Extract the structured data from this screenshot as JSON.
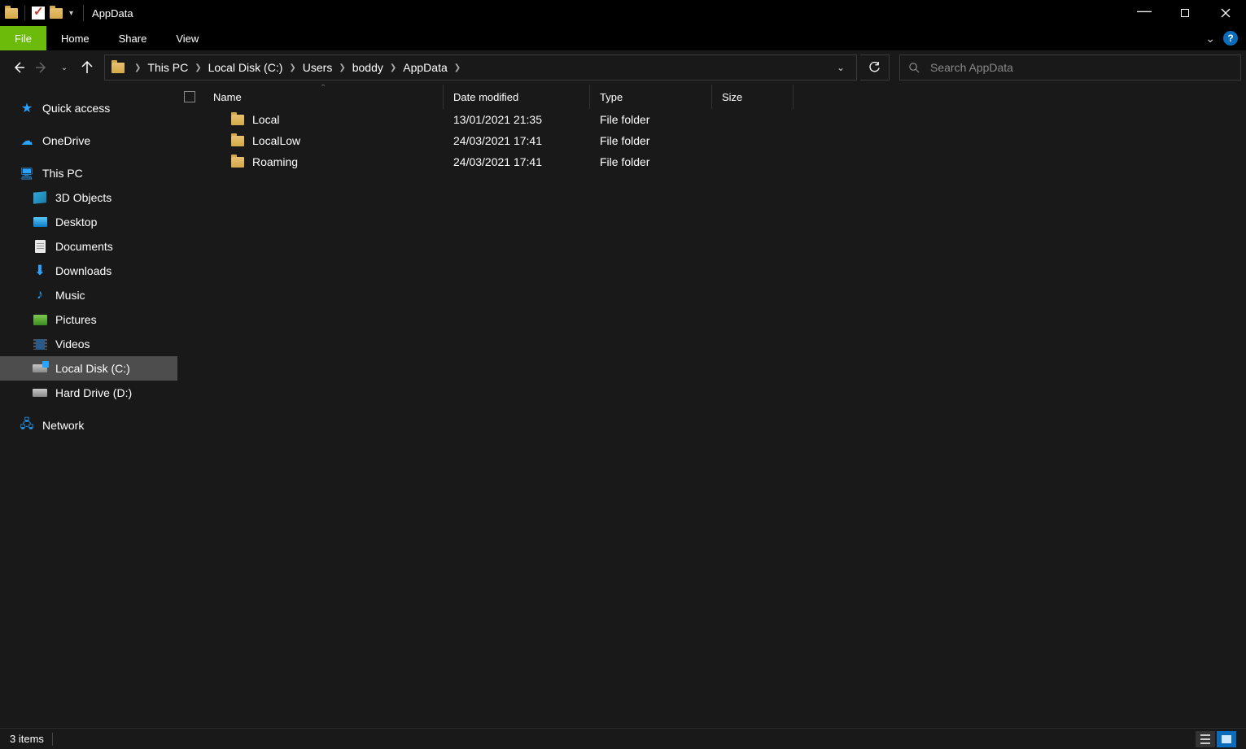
{
  "title": "AppData",
  "ribbon": {
    "file": "File",
    "tabs": [
      "Home",
      "Share",
      "View"
    ]
  },
  "breadcrumb": [
    "This PC",
    "Local Disk (C:)",
    "Users",
    "boddy",
    "AppData"
  ],
  "search": {
    "placeholder": "Search AppData"
  },
  "tree": {
    "quick_access": "Quick access",
    "onedrive": "OneDrive",
    "this_pc": "This PC",
    "pc_children": [
      "3D Objects",
      "Desktop",
      "Documents",
      "Downloads",
      "Music",
      "Pictures",
      "Videos",
      "Local Disk (C:)",
      "Hard Drive (D:)"
    ],
    "network": "Network"
  },
  "columns": {
    "name": "Name",
    "date": "Date modified",
    "type": "Type",
    "size": "Size"
  },
  "rows": [
    {
      "name": "Local",
      "date": "13/01/2021 21:35",
      "type": "File folder"
    },
    {
      "name": "LocalLow",
      "date": "24/03/2021 17:41",
      "type": "File folder"
    },
    {
      "name": "Roaming",
      "date": "24/03/2021 17:41",
      "type": "File folder"
    }
  ],
  "status": {
    "items": "3 items"
  }
}
